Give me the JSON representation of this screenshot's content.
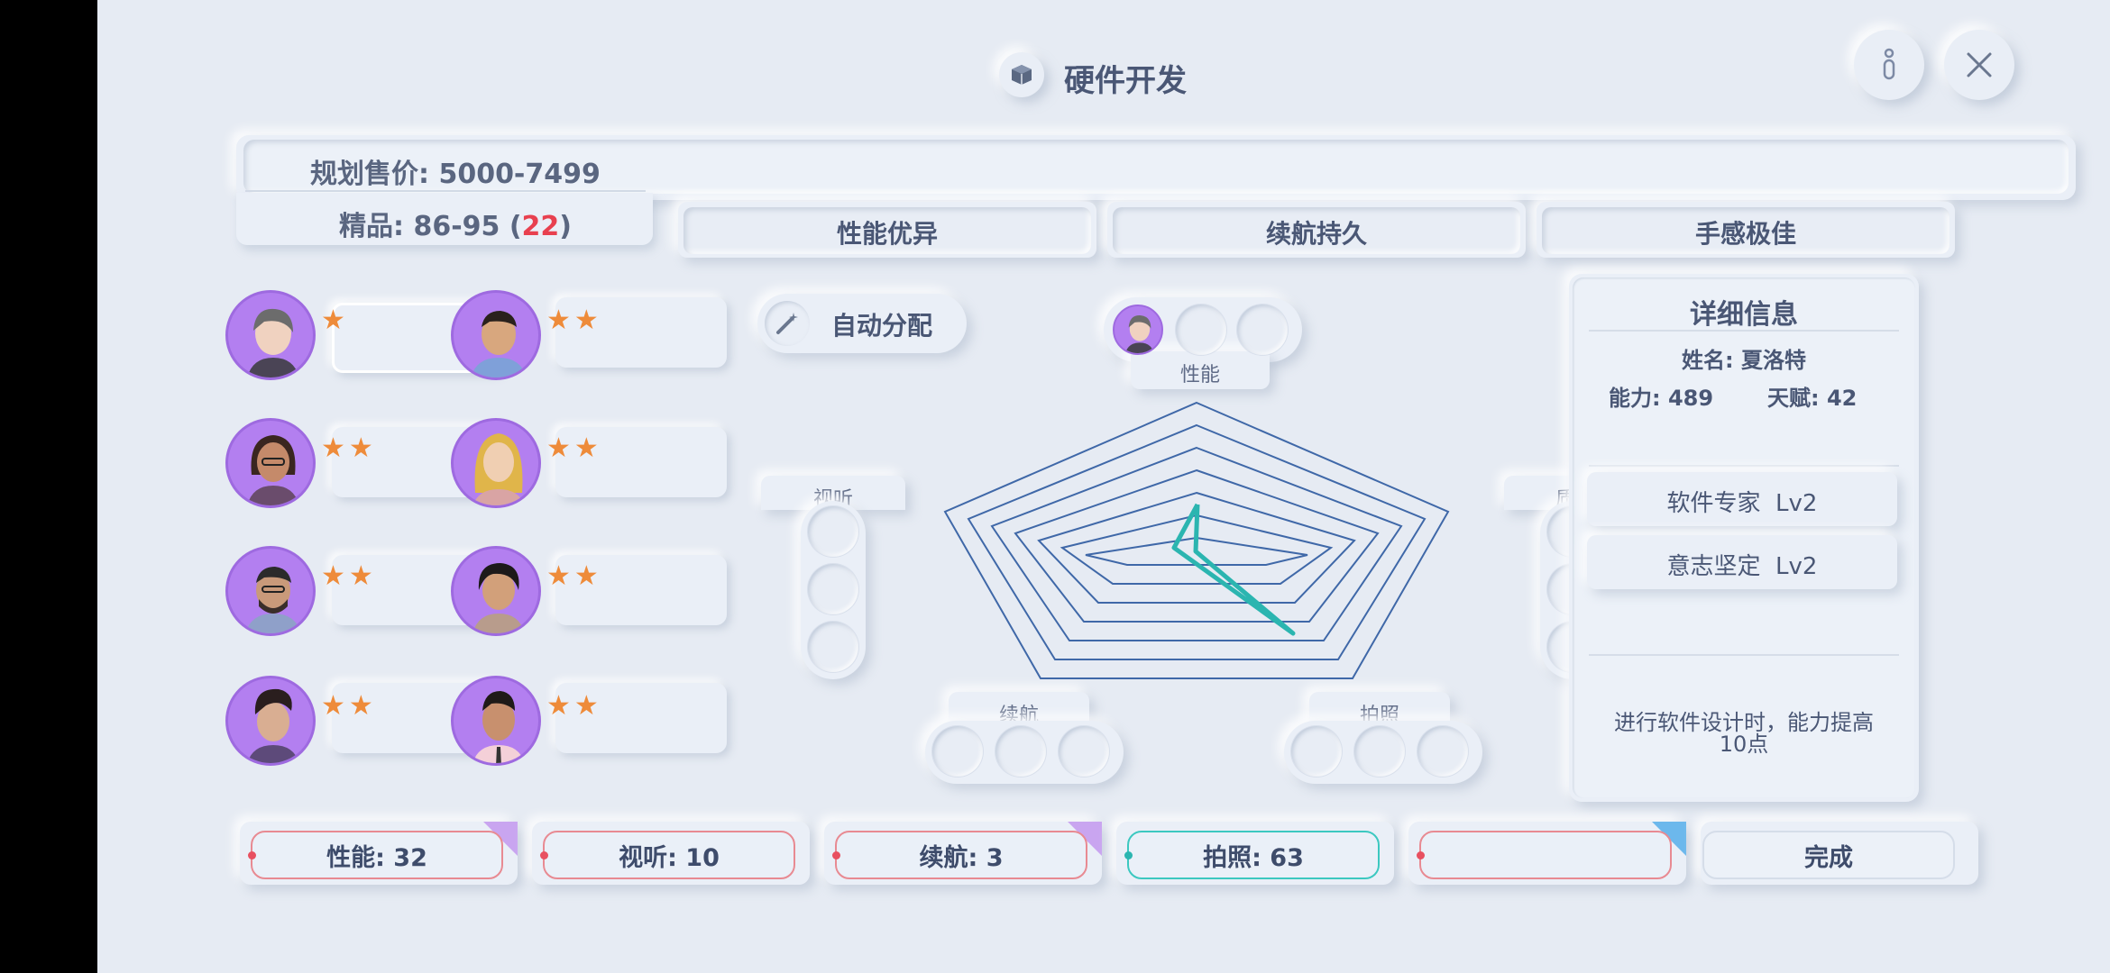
{
  "header": {
    "title": "硬件开发",
    "info_icon": "info-icon",
    "close_icon": "close-icon",
    "title_icon": "cube-icon"
  },
  "plan": {
    "price_label": "规划售价: 5000-7499",
    "quality_label": "精品: 86-95 (",
    "quality_count": "22",
    "quality_close": ")"
  },
  "features": [
    "性能优异",
    "续航持久",
    "手感极佳"
  ],
  "auto_assign": {
    "label": "自动分配"
  },
  "employees": [
    {
      "stars": "★"
    },
    {
      "stars": "★★"
    },
    {
      "stars": "★★"
    },
    {
      "stars": "★★"
    },
    {
      "stars": "★★"
    },
    {
      "stars": "★★"
    },
    {
      "stars": "★★"
    },
    {
      "stars": "★★"
    }
  ],
  "radar_labels": {
    "performance": "性能",
    "audio": "视听",
    "quality": "质量",
    "battery": "续航",
    "camera": "拍照"
  },
  "details": {
    "title": "详细信息",
    "name": "姓名: 夏洛特",
    "ability": "能力: 489",
    "talent": "天赋: 42",
    "skills": [
      "软件专家  Lv2",
      "意志坚定  Lv2"
    ],
    "description_line1": "进行软件设计时，能力提高",
    "description_line2": "10点"
  },
  "stats": [
    {
      "label": "性能: 32",
      "color": "#e85060"
    },
    {
      "label": "视听: 10",
      "color": "#e85060"
    },
    {
      "label": "续航: 3",
      "color": "#e85060"
    },
    {
      "label": "拍照: 63",
      "color": "#3cc8c0"
    },
    {
      "label": "",
      "color": "#e85060"
    }
  ],
  "done": {
    "label": "完成"
  },
  "colors": {
    "bg": "#e6ebf3",
    "accent_red": "#e8404f",
    "teal": "#2bb5b0",
    "star": "#ee8b3a",
    "avatar": "#b37ff0",
    "radar_line": "#3f68a8"
  }
}
